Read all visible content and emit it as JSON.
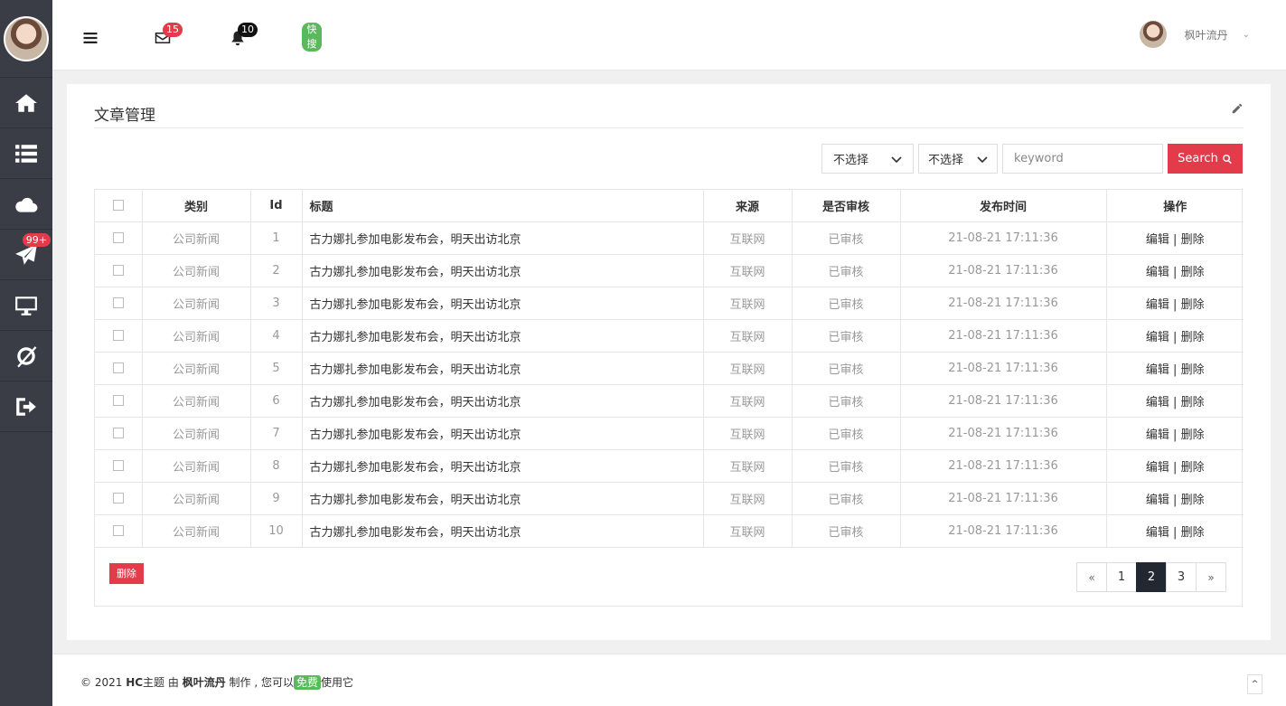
{
  "sidebar": {
    "items": [
      {
        "name": "home",
        "icon": "home-icon",
        "badge": ""
      },
      {
        "name": "list",
        "icon": "list-icon",
        "badge": ""
      },
      {
        "name": "cloud",
        "icon": "cloud-icon",
        "badge": ""
      },
      {
        "name": "send",
        "icon": "paper-plane-icon",
        "badge": "99+"
      },
      {
        "name": "desktop",
        "icon": "desktop-icon",
        "badge": ""
      },
      {
        "name": "o-slash",
        "icon": "o-slash-icon",
        "badge": ""
      },
      {
        "name": "logout",
        "icon": "sign-out-icon",
        "badge": ""
      }
    ]
  },
  "topbar": {
    "mail_badge": "15",
    "bell_badge": "10",
    "search_badge": "快搜",
    "user_name": "枫叶流丹"
  },
  "panel": {
    "title": "文章管理"
  },
  "filters": {
    "select1": "不选择",
    "select2": "不选择",
    "keyword_placeholder": "keyword",
    "search_label": "Search"
  },
  "table": {
    "headers": {
      "category": "类别",
      "id": "Id",
      "title": "标题",
      "source": "来源",
      "reviewed": "是否审核",
      "published": "发布时间",
      "actions": "操作"
    },
    "rows": [
      {
        "category": "公司新闻",
        "id": "1",
        "title": "古力娜扎参加电影发布会，明天出访北京",
        "source": "互联网",
        "reviewed": "已审核",
        "published": "21-08-21 17:11:36",
        "edit": "编辑",
        "sep": "|",
        "del": "删除"
      },
      {
        "category": "公司新闻",
        "id": "2",
        "title": "古力娜扎参加电影发布会，明天出访北京",
        "source": "互联网",
        "reviewed": "已审核",
        "published": "21-08-21 17:11:36",
        "edit": "编辑",
        "sep": "|",
        "del": "删除"
      },
      {
        "category": "公司新闻",
        "id": "3",
        "title": "古力娜扎参加电影发布会，明天出访北京",
        "source": "互联网",
        "reviewed": "已审核",
        "published": "21-08-21 17:11:36",
        "edit": "编辑",
        "sep": "|",
        "del": "删除"
      },
      {
        "category": "公司新闻",
        "id": "4",
        "title": "古力娜扎参加电影发布会，明天出访北京",
        "source": "互联网",
        "reviewed": "已审核",
        "published": "21-08-21 17:11:36",
        "edit": "编辑",
        "sep": "|",
        "del": "删除"
      },
      {
        "category": "公司新闻",
        "id": "5",
        "title": "古力娜扎参加电影发布会，明天出访北京",
        "source": "互联网",
        "reviewed": "已审核",
        "published": "21-08-21 17:11:36",
        "edit": "编辑",
        "sep": "|",
        "del": "删除"
      },
      {
        "category": "公司新闻",
        "id": "6",
        "title": "古力娜扎参加电影发布会，明天出访北京",
        "source": "互联网",
        "reviewed": "已审核",
        "published": "21-08-21 17:11:36",
        "edit": "编辑",
        "sep": "|",
        "del": "删除"
      },
      {
        "category": "公司新闻",
        "id": "7",
        "title": "古力娜扎参加电影发布会，明天出访北京",
        "source": "互联网",
        "reviewed": "已审核",
        "published": "21-08-21 17:11:36",
        "edit": "编辑",
        "sep": "|",
        "del": "删除"
      },
      {
        "category": "公司新闻",
        "id": "8",
        "title": "古力娜扎参加电影发布会，明天出访北京",
        "source": "互联网",
        "reviewed": "已审核",
        "published": "21-08-21 17:11:36",
        "edit": "编辑",
        "sep": "|",
        "del": "删除"
      },
      {
        "category": "公司新闻",
        "id": "9",
        "title": "古力娜扎参加电影发布会，明天出访北京",
        "source": "互联网",
        "reviewed": "已审核",
        "published": "21-08-21 17:11:36",
        "edit": "编辑",
        "sep": "|",
        "del": "删除"
      },
      {
        "category": "公司新闻",
        "id": "10",
        "title": "古力娜扎参加电影发布会，明天出访北京",
        "source": "互联网",
        "reviewed": "已审核",
        "published": "21-08-21 17:11:36",
        "edit": "编辑",
        "sep": "|",
        "del": "删除"
      }
    ]
  },
  "bulk_delete_label": "删除",
  "pagination": {
    "prev": "«",
    "pages": [
      "1",
      "2",
      "3"
    ],
    "current": "2",
    "next": "»"
  },
  "footer": {
    "copyright": "© 2021",
    "theme": "HC",
    "theme_suffix": "主题 由",
    "author": "枫叶流丹",
    "made": "制作 , 您可以",
    "free": "免费",
    "use": "使用它",
    "back_top": "^"
  },
  "colors": {
    "accent": "#e23c4b",
    "sidebar_bg": "#3b3d46",
    "active_page": "#222831",
    "badge_green": "#5cb85c"
  }
}
